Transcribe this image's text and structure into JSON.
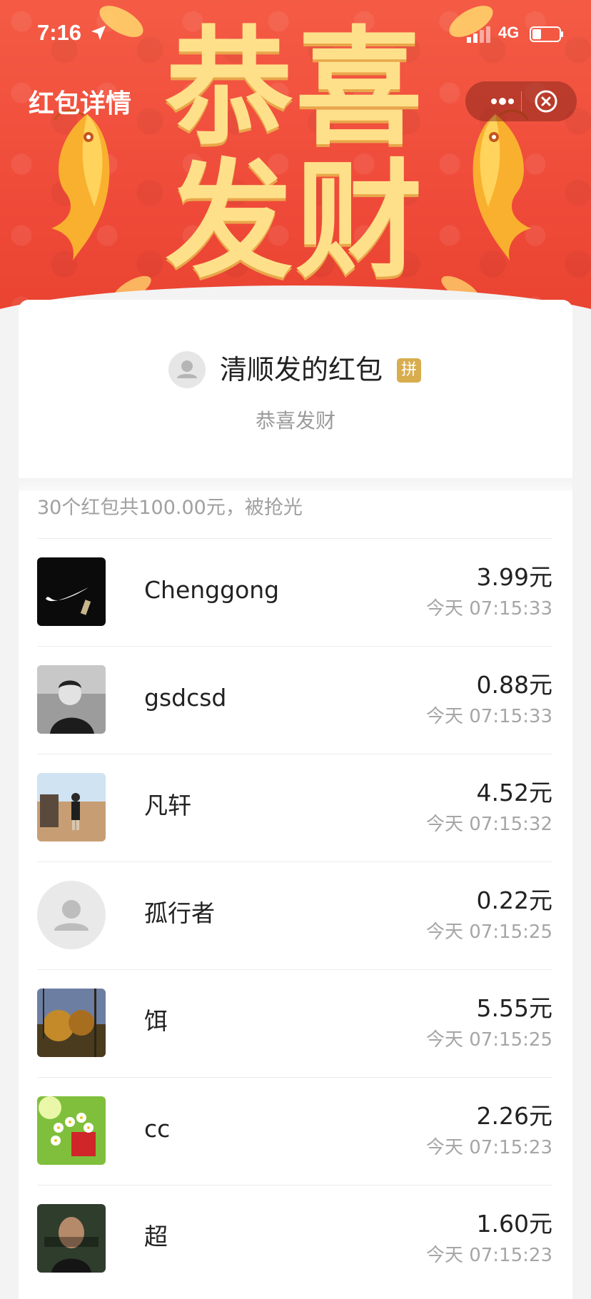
{
  "status_bar": {
    "time": "7:16",
    "network": "4G"
  },
  "header": {
    "title": "红包详情",
    "banner_line1": "恭喜",
    "banner_line2": "发财"
  },
  "sender": {
    "name": "清顺发的红包",
    "badge": "拼",
    "blessing": "恭喜发财"
  },
  "summary": "30个红包共100.00元，被抢光",
  "recipients": [
    {
      "name": "Chenggong",
      "amount": "3.99元",
      "time": "今天 07:15:33"
    },
    {
      "name": "gsdcsd",
      "amount": "0.88元",
      "time": "今天 07:15:33"
    },
    {
      "name": "凡轩",
      "amount": "4.52元",
      "time": "今天 07:15:32"
    },
    {
      "name": "孤行者",
      "amount": "0.22元",
      "time": "今天 07:15:25"
    },
    {
      "name": "饵",
      "amount": "5.55元",
      "time": "今天 07:15:25"
    },
    {
      "name": "cc",
      "amount": "2.26元",
      "time": "今天 07:15:23"
    },
    {
      "name": "超",
      "amount": "1.60元",
      "time": "今天 07:15:23"
    }
  ],
  "colors": {
    "banner_red": "#ef4a39",
    "banner_gold": "#ffe08a",
    "badge_gold": "#d8ad4e"
  }
}
